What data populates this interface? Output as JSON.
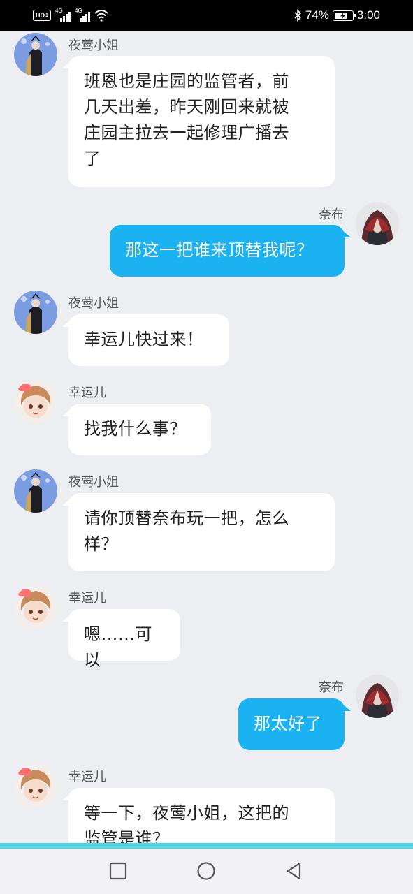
{
  "status_bar": {
    "hd_label": "HD",
    "hd_sub": "1",
    "signal1_tag": "4G",
    "signal2_tag": "4G",
    "battery_percent_label": "74%",
    "battery_level": 0.74,
    "time": "3:00",
    "icons": [
      "hd-icon",
      "signal-icon",
      "signal-icon",
      "wifi-icon",
      "bluetooth-icon",
      "battery-icon"
    ]
  },
  "messages": [
    {
      "side": "left",
      "sender": "夜莺小姐",
      "avatar": "nightingale-avatar",
      "lines": [
        "班恩也是庄园的监管者，前",
        "几天出差，昨天刚回来就被",
        "庄园主拉去一起修理广播去",
        "了"
      ]
    },
    {
      "side": "right",
      "sender": "奈布",
      "avatar": "naib-avatar",
      "lines": [
        "那这一把谁来顶替我呢？"
      ]
    },
    {
      "side": "left",
      "sender": "夜莺小姐",
      "avatar": "nightingale-avatar",
      "lines": [
        "幸运儿快过来！"
      ]
    },
    {
      "side": "left",
      "sender": "幸运儿",
      "avatar": "lucky-guy-avatar",
      "lines": [
        "找我什么事？"
      ]
    },
    {
      "side": "left",
      "sender": "夜莺小姐",
      "avatar": "nightingale-avatar",
      "lines": [
        "请你顶替奈布玩一把，怎么",
        "样？"
      ]
    },
    {
      "side": "left",
      "sender": "幸运儿",
      "avatar": "lucky-guy-avatar",
      "lines": [
        "嗯……可以"
      ]
    },
    {
      "side": "right",
      "sender": "奈布",
      "avatar": "naib-avatar",
      "lines": [
        "那太好了"
      ]
    },
    {
      "side": "left",
      "sender": "幸运儿",
      "avatar": "lucky-guy-avatar",
      "lines": [
        "等一下，夜莺小姐，这把的",
        "监管是谁？"
      ]
    }
  ],
  "nav_bar": {
    "buttons": [
      "recent-apps-icon",
      "home-icon",
      "back-icon"
    ]
  },
  "colors": {
    "background": "#eceef2",
    "bubble_left": "#ffffff",
    "bubble_right": "#1ab2f0",
    "nav_divider": "#4fd4e4",
    "status_bar": "#000000"
  }
}
